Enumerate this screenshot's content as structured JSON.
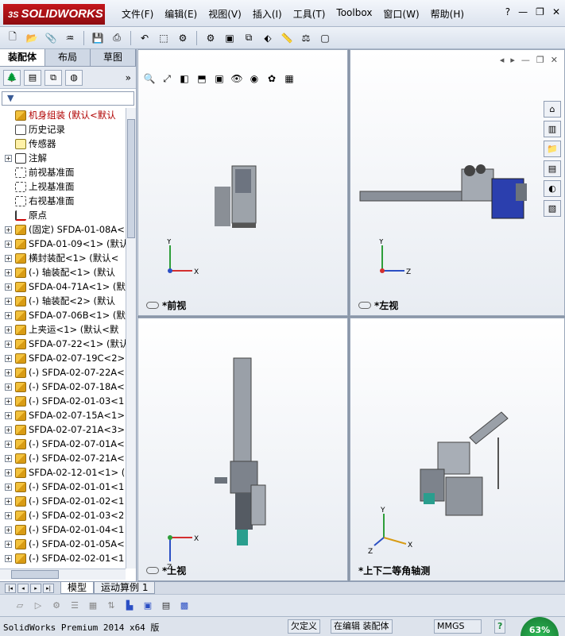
{
  "app": {
    "logo": "SOLIDWORKS",
    "logo_ds": "3S"
  },
  "menu": [
    "文件(F)",
    "编辑(E)",
    "视图(V)",
    "插入(I)",
    "工具(T)",
    "Toolbox",
    "窗口(W)",
    "帮助(H)"
  ],
  "tabs": [
    "装配体",
    "布局",
    "草图"
  ],
  "tree": [
    {
      "label": "机身组装  (默认<默认",
      "icon": "asm",
      "exp": ""
    },
    {
      "label": "历史记录",
      "icon": "hist",
      "exp": "none"
    },
    {
      "label": "传感器",
      "icon": "sensor",
      "exp": "none"
    },
    {
      "label": "注解",
      "icon": "note",
      "exp": "+"
    },
    {
      "label": "前视基准面",
      "icon": "plane",
      "exp": "none"
    },
    {
      "label": "上视基准面",
      "icon": "plane",
      "exp": "none"
    },
    {
      "label": "右视基准面",
      "icon": "plane",
      "exp": "none"
    },
    {
      "label": "原点",
      "icon": "origin",
      "exp": "none"
    },
    {
      "label": "(固定) SFDA-01-08A<",
      "icon": "asm",
      "exp": "+"
    },
    {
      "label": "SFDA-01-09<1> (默认",
      "icon": "asm",
      "exp": "+"
    },
    {
      "label": "横封装配<1> (默认<",
      "icon": "asm",
      "exp": "+"
    },
    {
      "label": "(-) 轴装配<1> (默认",
      "icon": "asm",
      "exp": "+"
    },
    {
      "label": "SFDA-04-71A<1> (默",
      "icon": "asm",
      "exp": "+"
    },
    {
      "label": "(-) 轴装配<2> (默认",
      "icon": "asm",
      "exp": "+"
    },
    {
      "label": "SFDA-07-06B<1> (默",
      "icon": "asm",
      "exp": "+"
    },
    {
      "label": "上夹运<1> (默认<默",
      "icon": "asm",
      "exp": "+"
    },
    {
      "label": "SFDA-07-22<1> (默认",
      "icon": "asm",
      "exp": "+"
    },
    {
      "label": "SFDA-02-07-19C<2> (",
      "icon": "asm",
      "exp": "+"
    },
    {
      "label": "(-) SFDA-02-07-22A<",
      "icon": "asm",
      "exp": "+"
    },
    {
      "label": "(-) SFDA-02-07-18A<",
      "icon": "asm",
      "exp": "+"
    },
    {
      "label": "(-) SFDA-02-01-03<1",
      "icon": "asm",
      "exp": "+"
    },
    {
      "label": "SFDA-02-07-15A<1> (",
      "icon": "asm",
      "exp": "+"
    },
    {
      "label": "SFDA-02-07-21A<3> (",
      "icon": "asm",
      "exp": "+"
    },
    {
      "label": "(-) SFDA-02-07-01A<",
      "icon": "asm",
      "exp": "+"
    },
    {
      "label": "(-) SFDA-02-07-21A<",
      "icon": "asm",
      "exp": "+"
    },
    {
      "label": "SFDA-02-12-01<1> (",
      "icon": "asm",
      "exp": "+"
    },
    {
      "label": "(-) SFDA-02-01-01<1",
      "icon": "asm",
      "exp": "+"
    },
    {
      "label": "(-) SFDA-02-01-02<1",
      "icon": "asm",
      "exp": "+"
    },
    {
      "label": "(-) SFDA-02-01-03<2",
      "icon": "asm",
      "exp": "+"
    },
    {
      "label": "(-) SFDA-02-01-04<1",
      "icon": "asm",
      "exp": "+"
    },
    {
      "label": "(-) SFDA-02-01-05A<",
      "icon": "asm",
      "exp": "+"
    },
    {
      "label": "(-) SFDA-02-02-01<1",
      "icon": "asm",
      "exp": "+"
    }
  ],
  "viewports": {
    "front": "*前视",
    "left": "*左视",
    "top": "*上视",
    "iso": "*上下二等角轴测"
  },
  "axes": {
    "x": "X",
    "y": "Y",
    "z": "Z"
  },
  "bottom_tabs": [
    "模型",
    "运动算例 1"
  ],
  "status": {
    "main": "SolidWorks Premium 2014 x64 版",
    "undefined": "欠定义",
    "editing": "在编辑 装配体",
    "units": "MMGS",
    "help": "?",
    "gauge": "63%"
  },
  "colors": {
    "logo_red": "#c4161c",
    "axis_x": "#d32f2f",
    "axis_y": "#2e9e3a",
    "axis_z": "#2b4fc4"
  }
}
